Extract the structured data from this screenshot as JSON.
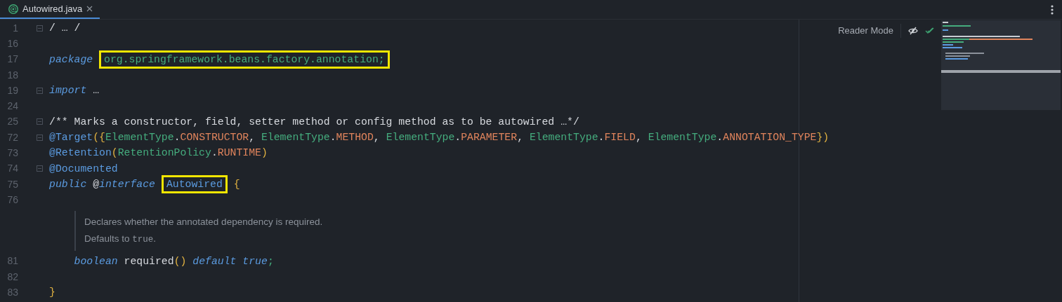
{
  "tab": {
    "label": "Autowired.java",
    "selected": true
  },
  "reader_mode": {
    "label": "Reader Mode"
  },
  "lines": [
    {
      "kind": "code",
      "number": "1",
      "fold": true,
      "tokens": [
        {
          "t": "/ … /",
          "kind": "plain"
        }
      ]
    },
    {
      "kind": "code",
      "number": "16"
    },
    {
      "kind": "code",
      "number": "17",
      "tokens": [
        {
          "t": "package",
          "kind": "kw"
        },
        {
          "t": "org.springframework.beans.factory.annotation;",
          "kind": "pkg",
          "highlighted": true
        }
      ]
    },
    {
      "kind": "code",
      "number": "18"
    },
    {
      "kind": "code",
      "number": "19",
      "fold": true,
      "tokens": [
        {
          "t": "import",
          "kind": "kw"
        },
        {
          "t": "…",
          "kind": "plain"
        }
      ]
    },
    {
      "kind": "code",
      "number": "24"
    },
    {
      "kind": "code",
      "number": "25",
      "fold": true,
      "tokens": [
        {
          "t": "/** Marks a constructor, field, setter method or config method as to be autowired …*/",
          "kind": "plain"
        }
      ]
    },
    {
      "kind": "code",
      "number": "72",
      "fold": true,
      "tokens": [
        {
          "t": "@Target",
          "kind": "annot"
        },
        {
          "t": "({",
          "kind": "brace"
        },
        {
          "t": "ElementType",
          "kind": "pkg"
        },
        {
          "t": ".",
          "kind": "plain"
        },
        {
          "t": "CONSTRUCTOR",
          "kind": "const"
        },
        {
          "t": ",",
          "kind": "plain"
        },
        {
          "t": "ElementType",
          "kind": "pkg"
        },
        {
          "t": ".",
          "kind": "plain"
        },
        {
          "t": "METHOD",
          "kind": "const"
        },
        {
          "t": ",",
          "kind": "plain"
        },
        {
          "t": "ElementType",
          "kind": "pkg"
        },
        {
          "t": ".",
          "kind": "plain"
        },
        {
          "t": "PARAMETER",
          "kind": "const"
        },
        {
          "t": ",",
          "kind": "plain"
        },
        {
          "t": "ElementType",
          "kind": "pkg"
        },
        {
          "t": ".",
          "kind": "plain"
        },
        {
          "t": "FIELD",
          "kind": "const"
        },
        {
          "t": ",",
          "kind": "plain"
        },
        {
          "t": "ElementType",
          "kind": "pkg"
        },
        {
          "t": ".",
          "kind": "plain"
        },
        {
          "t": "ANNOTATION_TYPE",
          "kind": "const"
        },
        {
          "t": "})",
          "kind": "brace"
        }
      ]
    },
    {
      "kind": "code",
      "number": "73",
      "tokens": [
        {
          "t": "@Retention",
          "kind": "annot"
        },
        {
          "t": "(",
          "kind": "brace"
        },
        {
          "t": "RetentionPolicy",
          "kind": "pkg"
        },
        {
          "t": ".",
          "kind": "plain"
        },
        {
          "t": "RUNTIME",
          "kind": "const"
        },
        {
          "t": ")",
          "kind": "brace"
        }
      ]
    },
    {
      "kind": "code",
      "number": "74",
      "fold": true,
      "tokens": [
        {
          "t": "@Documented",
          "kind": "annot"
        }
      ]
    },
    {
      "kind": "code",
      "number": "75",
      "tokens": [
        {
          "t": "public",
          "kind": "kw"
        },
        {
          "t": "@",
          "kind": "plain"
        },
        {
          "t": "interface",
          "kind": "kw"
        },
        {
          "t": "Autowired",
          "kind": "annot",
          "highlighted": true
        },
        {
          "t": "{",
          "kind": "brace"
        }
      ],
      "children": [
        {
          "kind": "code",
          "number": "76"
        },
        {
          "kind": "doc",
          "paragraphs": [
            [
              {
                "t": "Declares whether the annotated dependency is required."
              }
            ],
            [
              {
                "t": "Defaults to "
              },
              {
                "t": "true",
                "code": true
              },
              {
                "t": "."
              }
            ]
          ]
        },
        {
          "kind": "code",
          "number": "81",
          "tokens": [
            {
              "t": "boolean",
              "kind": "kw"
            },
            {
              "t": "required",
              "kind": "plain"
            },
            {
              "t": "()",
              "kind": "brace"
            },
            {
              "t": "default",
              "kind": "kw"
            },
            {
              "t": "true",
              "kind": "kw"
            },
            {
              "t": ";",
              "kind": "pkg"
            }
          ]
        },
        {
          "kind": "code",
          "number": "82"
        }
      ]
    },
    {
      "kind": "code",
      "number": "83",
      "tokens": [
        {
          "t": "}",
          "kind": "brace"
        }
      ]
    }
  ]
}
